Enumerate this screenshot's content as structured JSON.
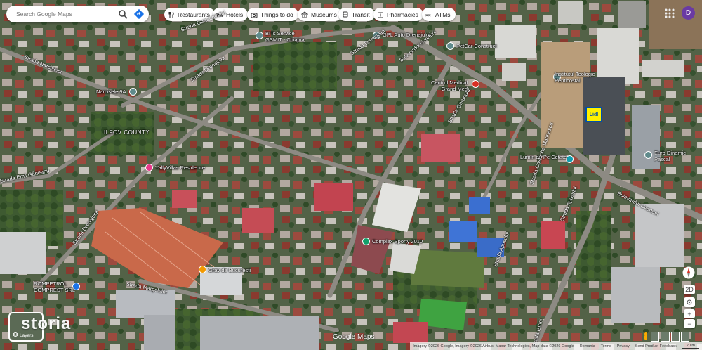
{
  "search": {
    "placeholder": "Search Google Maps"
  },
  "chips": [
    {
      "label": "Restaurants",
      "icon": "fork-knife-icon"
    },
    {
      "label": "Hotels",
      "icon": "bed-icon"
    },
    {
      "label": "Things to do",
      "icon": "camera-icon"
    },
    {
      "label": "Museums",
      "icon": "museum-icon"
    },
    {
      "label": "Transit",
      "icon": "bus-icon"
    },
    {
      "label": "Pharmacies",
      "icon": "pharmacy-icon"
    },
    {
      "label": "ATMs",
      "icon": "atm-icon"
    }
  ],
  "account": {
    "initial": "D"
  },
  "places": {
    "bits": "BITs Service\nGSMIT - Chiajna",
    "gpl": "GPL Auto Drenajului",
    "petcar": "PetCar Construct",
    "narcisele": "Narcisele 9A",
    "ilfov": "ILFOV COUNTY",
    "centrul": "Centrul Medical\nGrand Med",
    "institutul": "Institutul Teologic\nPenticostal",
    "lidl": "Lidl",
    "lumin": "Lumin de Pe Cetate",
    "eurb": "Eurb Dinamic\nPascal",
    "yally": "YallyVillas Residence",
    "complex": "Complex Sporty 2010",
    "grav": "Grav de Bucuresti",
    "rompetrol": "ROMPETROL\nCOMPREST SRL"
  },
  "streets": {
    "s1": "Strada Narciselor",
    "s2": "Strada Gura Lotrului",
    "s3": "Strada Drenajului",
    "s4": "Bulevardul Uverturii",
    "s5": "Strada Drenajului",
    "s6": "Strada Emil Gârleanu",
    "s7": "Strada Drenajului",
    "s8": "Strada Margelelor",
    "s9": "Strada Apusului",
    "s10": "Strada Gorunului",
    "s11": "Strada Apusului",
    "s12": "Bulevardul Uverturii",
    "s13": "Strada Istriei",
    "s14": "Strada Costache Marinescu"
  },
  "layers": {
    "label": "Layers"
  },
  "watermark": "storia",
  "google_logo": "Google Maps",
  "footer": {
    "imagery": "Imagery ©2026 Google, Imagery ©2026 Airbus, Maxar Technologies, Map data ©2026 Google",
    "links": [
      "Romania",
      "Terms",
      "Privacy",
      "Send Product Feedback"
    ],
    "scale": "20 m"
  },
  "controls": {
    "tilt": "2D",
    "zoom_in": "+",
    "zoom_out": "−"
  },
  "colors": {
    "accent": "#1a73e8",
    "pin_teal": "#129eaf",
    "pin_pink": "#e8388a",
    "pin_orange": "#f29900",
    "pin_red": "#d93025",
    "pin_gray": "#5f8a8b"
  }
}
